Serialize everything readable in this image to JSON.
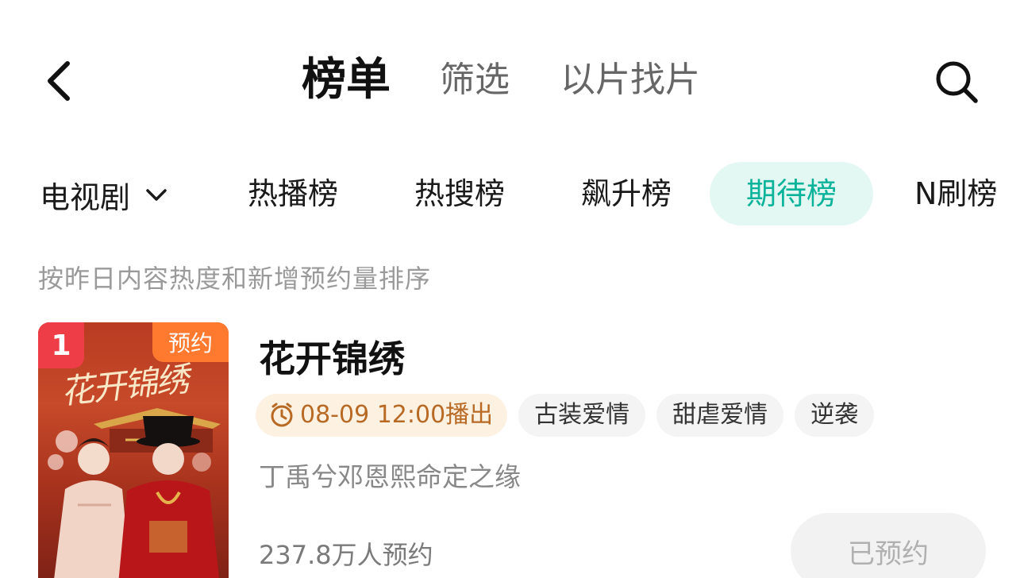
{
  "header": {
    "tabs": [
      {
        "label": "榜单",
        "active": true
      },
      {
        "label": "筛选",
        "active": false
      },
      {
        "label": "以片找片",
        "active": false
      }
    ]
  },
  "category": {
    "selected": "电视剧",
    "rank_tabs": [
      {
        "label": "热播榜",
        "active": false
      },
      {
        "label": "热搜榜",
        "active": false
      },
      {
        "label": "飙升榜",
        "active": false
      },
      {
        "label": "期待榜",
        "active": true
      },
      {
        "label": "N刷榜",
        "active": false
      }
    ]
  },
  "subtitle": "按昨日内容热度和新增预约量排序",
  "items": [
    {
      "rank": "1",
      "poster_badge": "预约",
      "poster_title": "花开锦绣",
      "title": "花开锦绣",
      "air_time": "08-09 12:00播出",
      "tags": [
        "古装爱情",
        "甜虐爱情",
        "逆袭"
      ],
      "description": "丁禹兮邓恩熙命定之缘",
      "reservation_count": "237.8万人预约",
      "button_label": "已预约"
    }
  ],
  "colors": {
    "accent": "#0bb39a",
    "accent_bg": "#e3f7f3",
    "rank_badge": "#ef3d48",
    "reserve_badge": "#ff7a2f",
    "air_time_text": "#b86a25",
    "air_time_bg": "#fdf1e2"
  },
  "icons": {
    "back": "chevron-left-icon",
    "search": "search-icon",
    "dropdown": "chevron-down-icon",
    "air_time": "clock-icon"
  }
}
